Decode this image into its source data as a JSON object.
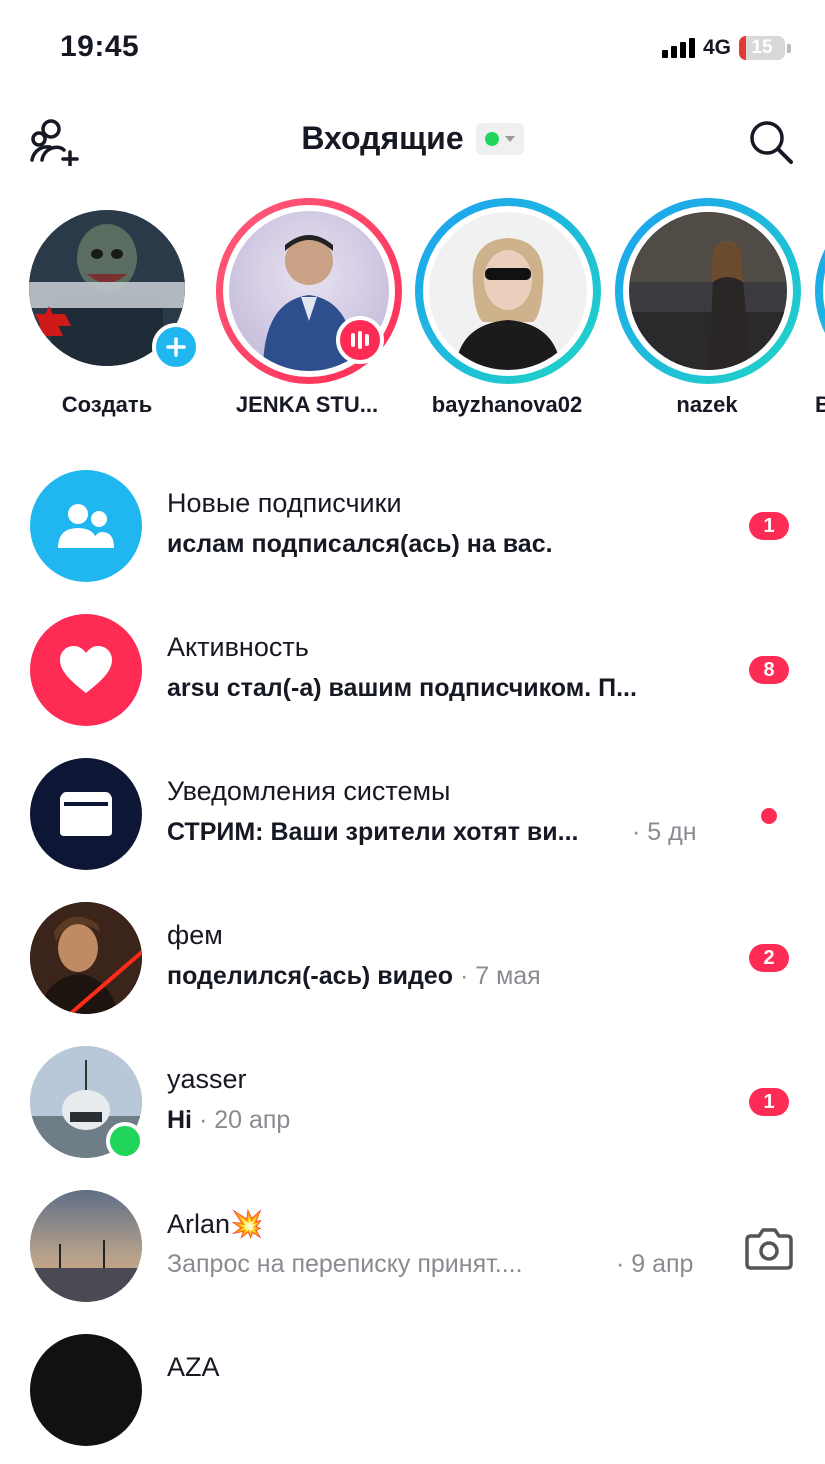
{
  "status_bar": {
    "time": "19:45",
    "network": "4G",
    "battery": "15",
    "battery_level": 0.15
  },
  "header": {
    "title": "Входящие"
  },
  "stories": [
    {
      "label": "Создать",
      "type": "create"
    },
    {
      "label": "JENKA STU...",
      "type": "live"
    },
    {
      "label": "bayzhanova02",
      "type": "story"
    },
    {
      "label": "nazek",
      "type": "story"
    },
    {
      "label": "B",
      "type": "story"
    }
  ],
  "inbox": [
    {
      "title": "Новые подписчики",
      "subtitle": "ислам подписался(ась) на вас.",
      "time": "",
      "badge": "1",
      "icon": "followers-icon"
    },
    {
      "title": "Активность",
      "subtitle": "arsu стал(-а) вашим подписчиком. П...",
      "time": "",
      "badge": "8",
      "icon": "heart-icon"
    },
    {
      "title": "Уведомления системы",
      "subtitle": "СТРИМ: Ваши зрители хотят ви...",
      "time": "· 5 дн",
      "badge": "",
      "icon": "inbox-tray-icon"
    },
    {
      "title": "фем",
      "subtitle": "поделился(-ась) видео",
      "time": "· 7 мая",
      "badge": "2",
      "icon": ""
    },
    {
      "title": "yasser",
      "subtitle": "Hi",
      "time": "· 20 апр",
      "badge": "1",
      "icon": ""
    },
    {
      "title": "Arlan💥",
      "subtitle": "Запрос на переписку принят....",
      "time": "· 9 апр",
      "badge": "",
      "icon": "camera-icon"
    },
    {
      "title": "AZA",
      "subtitle": "",
      "time": "",
      "badge": "",
      "icon": ""
    }
  ],
  "colors": {
    "accent": "#fe2c55",
    "followers": "#20b7f1",
    "online": "#20d55a",
    "system": "#0d1634"
  }
}
